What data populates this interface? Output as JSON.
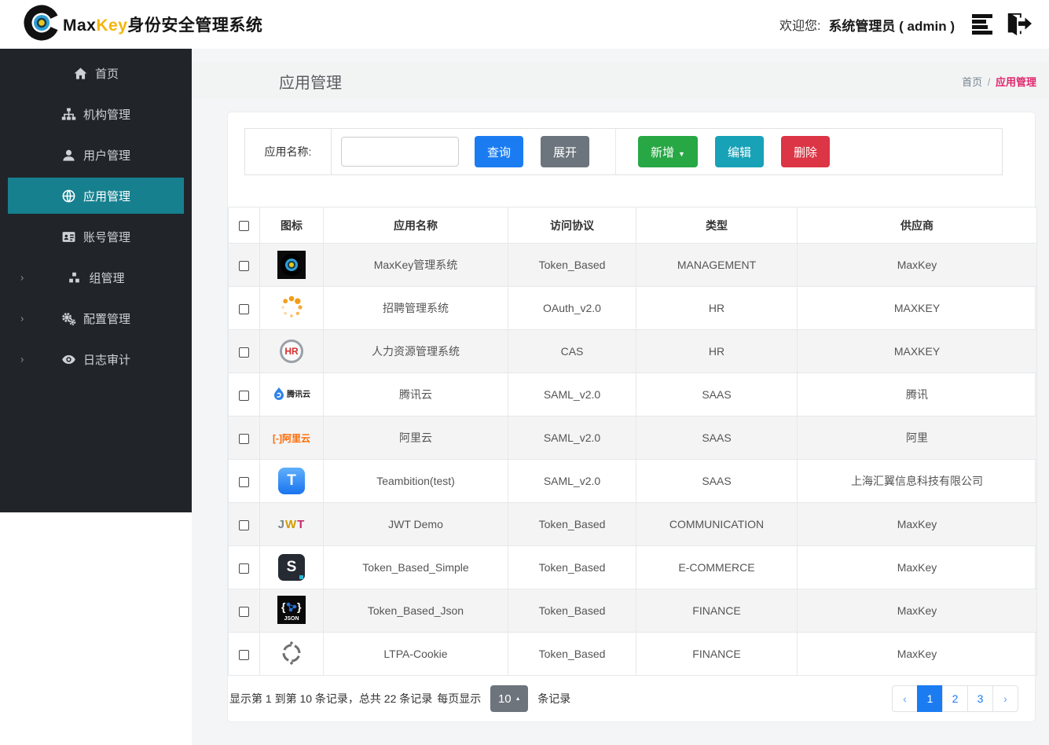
{
  "header": {
    "brand_max": "Max",
    "brand_key": "Key",
    "brand_suffix": "身份安全管理系统",
    "welcome_label": "欢迎您:",
    "user": "系统管理员 ( admin )",
    "icons": [
      "list-icon",
      "sign-out-icon"
    ]
  },
  "sidebar": {
    "items": [
      {
        "label": "首页",
        "icon": "home-icon",
        "active": false,
        "chevron": false
      },
      {
        "label": "机构管理",
        "icon": "sitemap-icon",
        "active": false,
        "chevron": false
      },
      {
        "label": "用户管理",
        "icon": "user-icon",
        "active": false,
        "chevron": false
      },
      {
        "label": "应用管理",
        "icon": "globe-icon",
        "active": true,
        "chevron": false
      },
      {
        "label": "账号管理",
        "icon": "id-card-icon",
        "active": false,
        "chevron": false
      },
      {
        "label": "组管理",
        "icon": "cubes-icon",
        "active": false,
        "chevron": true
      },
      {
        "label": "配置管理",
        "icon": "gears-icon",
        "active": false,
        "chevron": true
      },
      {
        "label": "日志审计",
        "icon": "eye-icon",
        "active": false,
        "chevron": true
      }
    ]
  },
  "page": {
    "title": "应用管理",
    "breadcrumb_home": "首页",
    "breadcrumb_sep": "/",
    "breadcrumb_current": "应用管理"
  },
  "search": {
    "label": "应用名称:",
    "input_value": "",
    "query_label": "查询",
    "expand_label": "展开",
    "add_label": "新增",
    "edit_label": "编辑",
    "delete_label": "删除"
  },
  "table": {
    "headers": [
      "图标",
      "应用名称",
      "访问协议",
      "类型",
      "供应商"
    ],
    "rows": [
      {
        "icon": "maxkey-logo-icon",
        "name": "MaxKey管理系统",
        "protocol": "Token_Based",
        "type": "MANAGEMENT",
        "vendor": "MaxKey"
      },
      {
        "icon": "spinner-icon",
        "name": "招聘管理系统",
        "protocol": "OAuth_v2.0",
        "type": "HR",
        "vendor": "MAXKEY"
      },
      {
        "icon": "hr-logo-icon",
        "name": "人力资源管理系统",
        "protocol": "CAS",
        "type": "HR",
        "vendor": "MAXKEY"
      },
      {
        "icon": "tencent-cloud-icon",
        "name": "腾讯云",
        "protocol": "SAML_v2.0",
        "type": "SAAS",
        "vendor": "腾讯"
      },
      {
        "icon": "alibaba-cloud-icon",
        "name": "阿里云",
        "protocol": "SAML_v2.0",
        "type": "SAAS",
        "vendor": "阿里"
      },
      {
        "icon": "teambition-icon",
        "name": "Teambition(test)",
        "protocol": "SAML_v2.0",
        "type": "SAAS",
        "vendor": "上海汇翼信息科技有限公司"
      },
      {
        "icon": "jwt-icon",
        "name": "JWT Demo",
        "protocol": "Token_Based",
        "type": "COMMUNICATION",
        "vendor": "MaxKey"
      },
      {
        "icon": "s-logo-icon",
        "name": "Token_Based_Simple",
        "protocol": "Token_Based",
        "type": "E-COMMERCE",
        "vendor": "MaxKey"
      },
      {
        "icon": "json-icon",
        "name": "Token_Based_Json",
        "protocol": "Token_Based",
        "type": "FINANCE",
        "vendor": "MaxKey"
      },
      {
        "icon": "ltpa-icon",
        "name": "LTPA-Cookie",
        "protocol": "Token_Based",
        "type": "FINANCE",
        "vendor": "MaxKey"
      }
    ]
  },
  "pagination": {
    "info": "显示第 1 到第 10 条记录，总共 22 条记录",
    "per_page_label": "每页显示",
    "page_size": "10",
    "per_page_suffix": "条记录",
    "prev": "‹",
    "next": "›",
    "pages": [
      "1",
      "2",
      "3"
    ],
    "active_page": "1"
  },
  "colors": {
    "primary_blue": "#1b7cf2",
    "success_green": "#28a745",
    "info_teal": "#17a2b8",
    "danger_red": "#dc3545",
    "secondary_gray": "#6c757d",
    "sidebar_bg": "#212529",
    "sidebar_active": "#17808f",
    "breadcrumb_active": "#e1266d",
    "brand_yellow": "#f5b50a",
    "stripe_row": "#f4f4f5"
  }
}
